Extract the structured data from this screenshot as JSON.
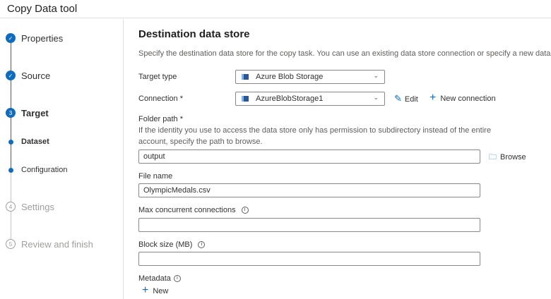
{
  "header": {
    "title": "Copy Data tool"
  },
  "steps": [
    {
      "label": "Properties",
      "state": "done",
      "icon": "check-icon"
    },
    {
      "label": "Source",
      "state": "done",
      "icon": "check-icon"
    },
    {
      "label": "Target",
      "state": "current",
      "number": "3"
    },
    {
      "label": "Dataset",
      "state": "substep"
    },
    {
      "label": "Configuration",
      "state": "substep"
    },
    {
      "label": "Settings",
      "state": "pending",
      "number": "4"
    },
    {
      "label": "Review and finish",
      "state": "pending",
      "number": "5"
    }
  ],
  "main": {
    "heading": "Destination data store",
    "description": "Specify the destination data store for the copy task. You can use an existing data store connection or specify a new data store.",
    "target_type": {
      "label": "Target type",
      "value": "Azure Blob Storage"
    },
    "connection": {
      "label": "Connection *",
      "value": "AzureBlobStorage1",
      "edit": "Edit",
      "new": "New connection"
    },
    "folder_path": {
      "label": "Folder path *",
      "help1": "If the identity you use to access the data store only has permission to subdirectory instead of the entire",
      "help2": "account, specify the path to browse.",
      "value": "output",
      "browse": "Browse"
    },
    "file_name": {
      "label": "File name",
      "value": "OlympicMedals.csv"
    },
    "max_conn": {
      "label": "Max concurrent connections",
      "value": ""
    },
    "block_size": {
      "label": "Block size (MB)",
      "value": ""
    },
    "metadata": {
      "label": "Metadata",
      "new": "New"
    }
  },
  "colors": {
    "accent": "#0f6cbd"
  }
}
